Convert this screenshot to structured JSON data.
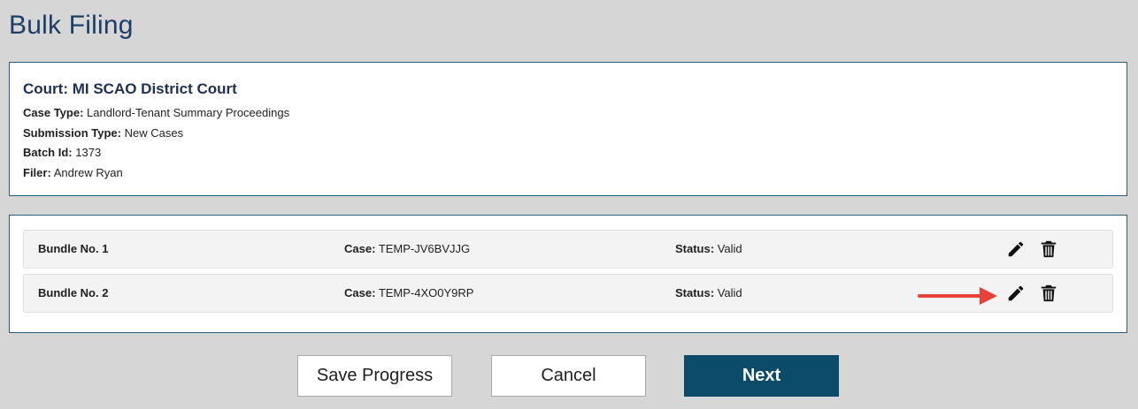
{
  "page": {
    "title": "Bulk Filing"
  },
  "info": {
    "court_label": "Court:",
    "court_value": "MI SCAO District Court",
    "rows": [
      {
        "label": "Case Type:",
        "value": "Landlord-Tenant Summary Proceedings"
      },
      {
        "label": "Submission Type:",
        "value": "New Cases"
      },
      {
        "label": "Batch Id:",
        "value": "1373"
      },
      {
        "label": "Filer:",
        "value": "Andrew Ryan"
      }
    ]
  },
  "bundles": [
    {
      "bundle": "Bundle No. 1",
      "case_label": "Case:",
      "case_value": "TEMP-JV6BVJJG",
      "status_label": "Status:",
      "status_value": "Valid",
      "edit_icon": "pencil-icon",
      "delete_icon": "trash-icon"
    },
    {
      "bundle": "Bundle No. 2",
      "case_label": "Case:",
      "case_value": "TEMP-4XO0Y9RP",
      "status_label": "Status:",
      "status_value": "Valid",
      "edit_icon": "pencil-icon",
      "delete_icon": "trash-icon"
    }
  ],
  "annotation": {
    "arrow_color": "#e8413c",
    "points_to": "bundle 2 edit icon"
  },
  "buttons": {
    "save": "Save Progress",
    "cancel": "Cancel",
    "next": "Next"
  },
  "colors": {
    "title": "#1d3f66",
    "panel_border": "#2d5c78",
    "primary": "#0d4b6a",
    "background": "#d6d6d6"
  }
}
